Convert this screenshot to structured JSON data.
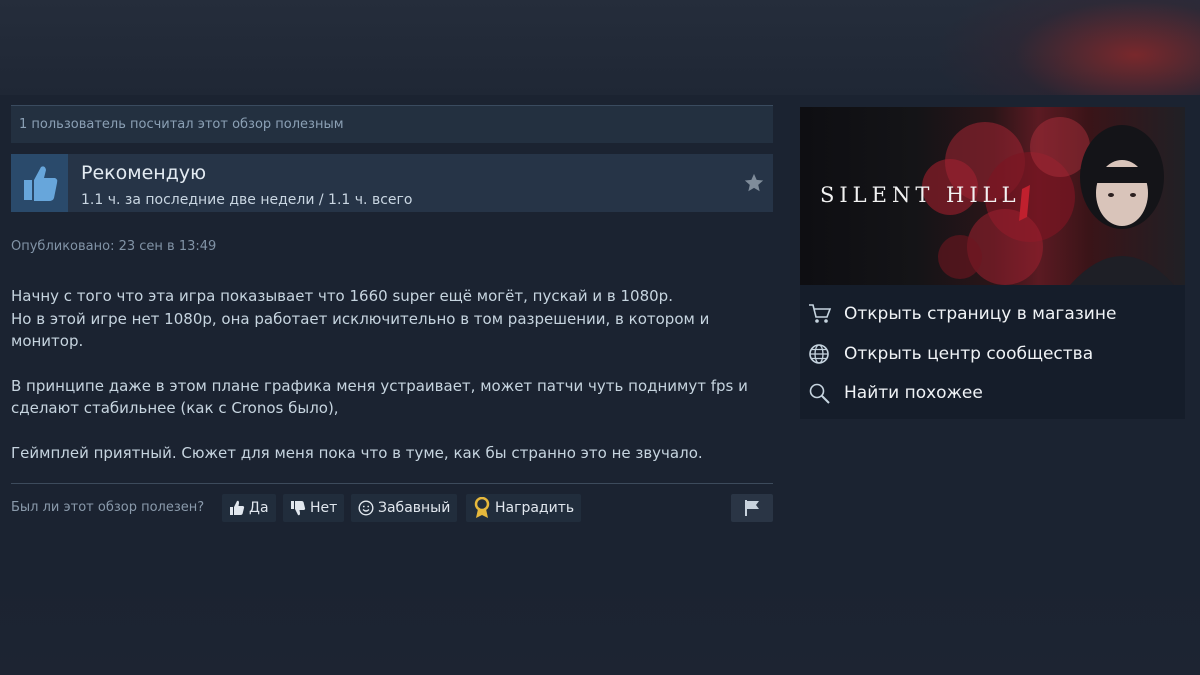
{
  "review": {
    "helpful_count_text": "1 пользователь посчитал этот обзор полезным",
    "verdict": "Рекомендую",
    "hours": "1.1 ч. за последние две недели / 1.1 ч. всего",
    "posted": "Опубликовано: 23 сен в 13:49",
    "paragraphs": [
      "Начну с того что эта игра показывает что 1660 super ещё могёт, пускай и в 1080p.\nНо в этой игре нет 1080p, она работает исключительно в том разрешении, в котором и монитор.",
      "В принципе даже в этом плане графика меня устраивает, может патчи чуть поднимут fps и сделают стабильнее (как с Cronos было),",
      "Геймплей приятный. Сюжет для меня пока что в туме, как бы странно это не звучало."
    ]
  },
  "rating": {
    "question": "Был ли этот обзор полезен?",
    "yes": "Да",
    "no": "Нет",
    "funny": "Забавный",
    "award": "Наградить"
  },
  "game": {
    "title": "SILENT HILL",
    "links": [
      {
        "label": "Открыть страницу в магазине",
        "icon": "cart-icon"
      },
      {
        "label": "Открыть центр сообщества",
        "icon": "globe-icon"
      },
      {
        "label": "Найти похожее",
        "icon": "search-icon"
      }
    ]
  },
  "colors": {
    "background": "#1b2331",
    "accent_thumb": "#2a4a6b",
    "award_gold": "#e6b83c",
    "capsule_red": "#8b1c2a"
  }
}
